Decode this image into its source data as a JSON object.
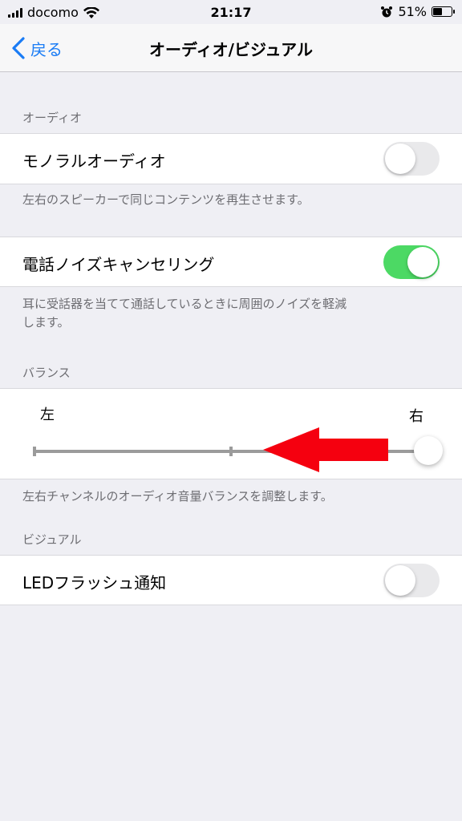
{
  "status_bar": {
    "carrier": "docomo",
    "time": "21:17",
    "battery_percent_text": "51%",
    "battery_level": 0.51
  },
  "navbar": {
    "back_label": "戻る",
    "title": "オーディオ/ビジュアル"
  },
  "audio_section": {
    "header": "オーディオ",
    "mono_audio_label": "モノラルオーディオ",
    "mono_audio_on": false,
    "mono_audio_footer": "左右のスピーカーで同じコンテンツを再生させます。",
    "noise_cancel_label": "電話ノイズキャンセリング",
    "noise_cancel_on": true,
    "noise_cancel_footer_line1": "耳に受話器を当てて通話しているときに周囲のノイズを軽減",
    "noise_cancel_footer_line2": "します。"
  },
  "balance_section": {
    "header": "バランス",
    "left_label": "左",
    "right_label": "右",
    "value": 1.0,
    "footer": "左右チャンネルのオーディオ音量バランスを調整します。"
  },
  "visual_section": {
    "header": "ビジュアル",
    "led_flash_label": "LEDフラッシュ通知",
    "led_flash_on": false
  },
  "colors": {
    "accent": "#1a7cf5",
    "switch_on": "#4cd964",
    "annotation_arrow": "#f5000f"
  },
  "icons": [
    "signal-bars-icon",
    "wifi-icon",
    "alarm-clock-icon",
    "battery-icon",
    "chevron-left-icon",
    "red-arrow-annotation-icon"
  ]
}
